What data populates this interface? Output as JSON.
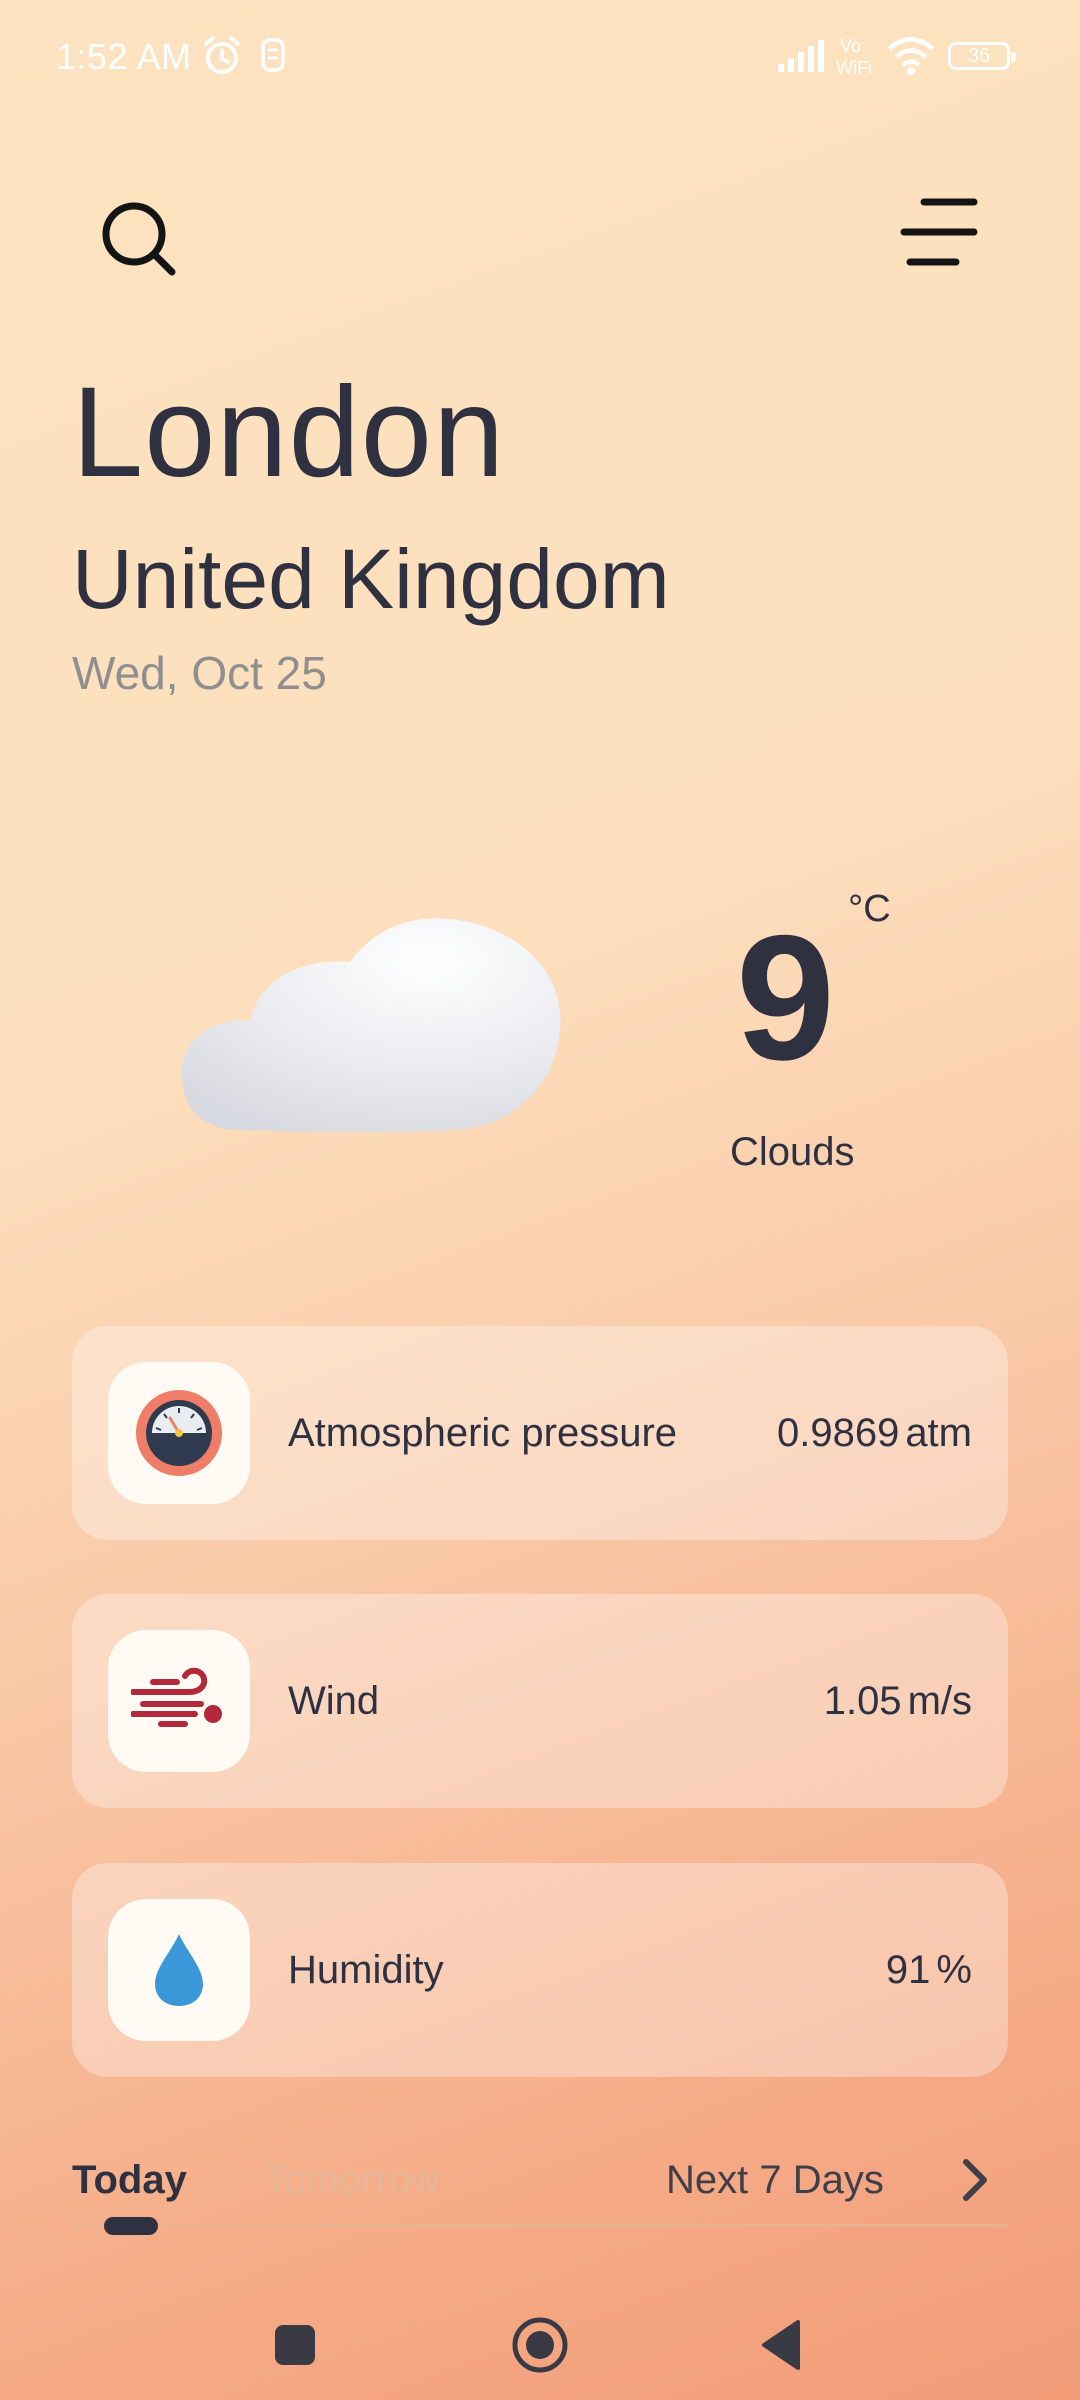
{
  "status_bar": {
    "time": "1:52 AM",
    "battery": "36",
    "icons": [
      "alarm-icon",
      "notification-icon",
      "signal-icon",
      "vowifi-icon",
      "wifi-icon",
      "battery-icon"
    ]
  },
  "header": {
    "search_icon": "search-icon",
    "menu_icon": "menu-icon"
  },
  "location": {
    "city": "London",
    "country": "United Kingdom",
    "date": "Wed, Oct 25"
  },
  "current": {
    "temperature": "9",
    "unit": "°C",
    "condition": "Clouds",
    "icon": "cloud-icon"
  },
  "details": [
    {
      "label": "Atmospheric pressure",
      "value": "0.9869",
      "unit": "atm",
      "icon": "gauge-icon"
    },
    {
      "label": "Wind",
      "value": "1.05",
      "unit": "m/s",
      "icon": "wind-icon"
    },
    {
      "label": "Humidity",
      "value": "91",
      "unit": "%",
      "icon": "droplet-icon"
    }
  ],
  "tabs": {
    "today": "Today",
    "tomorrow": "Tomorrow",
    "next7": "Next 7 Days",
    "active": "Today"
  },
  "colors": {
    "text_dark": "#2f3140",
    "text_muted": "#8f8f8f",
    "tab_inactive": "#e3b797",
    "wind_icon": "#b3283a",
    "droplet": "#3a98d8",
    "gauge_ring": "#ef7d68",
    "gauge_face": "#2f3a4e"
  }
}
